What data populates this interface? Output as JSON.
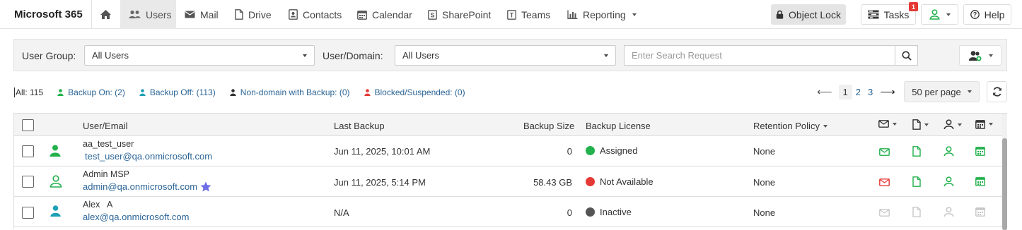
{
  "app": {
    "brand": "Microsoft 365"
  },
  "nav": {
    "home_icon": "home-icon",
    "items": [
      {
        "label": "Users",
        "icon": "users-icon"
      },
      {
        "label": "Mail",
        "icon": "envelope-icon"
      },
      {
        "label": "Drive",
        "icon": "file-icon"
      },
      {
        "label": "Contacts",
        "icon": "contact-card-icon"
      },
      {
        "label": "Calendar",
        "icon": "calendar-icon"
      },
      {
        "label": "SharePoint",
        "icon": "sharepoint-icon"
      },
      {
        "label": "Teams",
        "icon": "teams-icon"
      },
      {
        "label": "Reporting",
        "icon": "bar-chart-icon"
      }
    ],
    "object_lock": "Object Lock",
    "tasks": "Tasks",
    "tasks_badge": "1",
    "help": "Help"
  },
  "filters": {
    "user_group_label": "User Group:",
    "user_group_value": "All Users",
    "user_domain_label": "User/Domain:",
    "user_domain_value": "All Users",
    "search_placeholder": "Enter Search Request"
  },
  "summary": {
    "all": "All: 115",
    "backup_on": "Backup On: (2)",
    "backup_off": "Backup Off: (113)",
    "non_domain": "Non-domain with Backup: (0)",
    "blocked": "Blocked/Suspended: (0)"
  },
  "pager": {
    "pages": [
      "1",
      "2",
      "3"
    ],
    "per_page": "50 per page"
  },
  "table": {
    "headers": {
      "user": "User/Email",
      "last_backup": "Last Backup",
      "backup_size": "Backup Size",
      "backup_license": "Backup License",
      "retention": "Retention Policy"
    },
    "rows": [
      {
        "name": "aa_test_user",
        "email": "test_user@qa.onmicrosoft.com",
        "last_backup": "Jun 11, 2025, 10:01 AM",
        "size": "0",
        "license": "Assigned",
        "license_color": "#22b14c",
        "retention": "None"
      },
      {
        "name": "Admin MSP",
        "email": "admin@qa.onmicrosoft.com",
        "last_backup": "Jun 11, 2025, 5:14 PM",
        "size": "58.43 GB",
        "license": "Not Available",
        "license_color": "#e53935",
        "retention": "None"
      },
      {
        "name": "Alex   A",
        "email": "alex@qa.onmicrosoft.com",
        "last_backup": "N/A",
        "size": "0",
        "license": "Inactive",
        "license_color": "#555555",
        "retention": "None"
      }
    ]
  },
  "colors": {
    "link": "#2a6496",
    "green": "#22b14c",
    "teal": "#1fa0b5",
    "red": "#e53935",
    "star": "#6d6de8"
  }
}
